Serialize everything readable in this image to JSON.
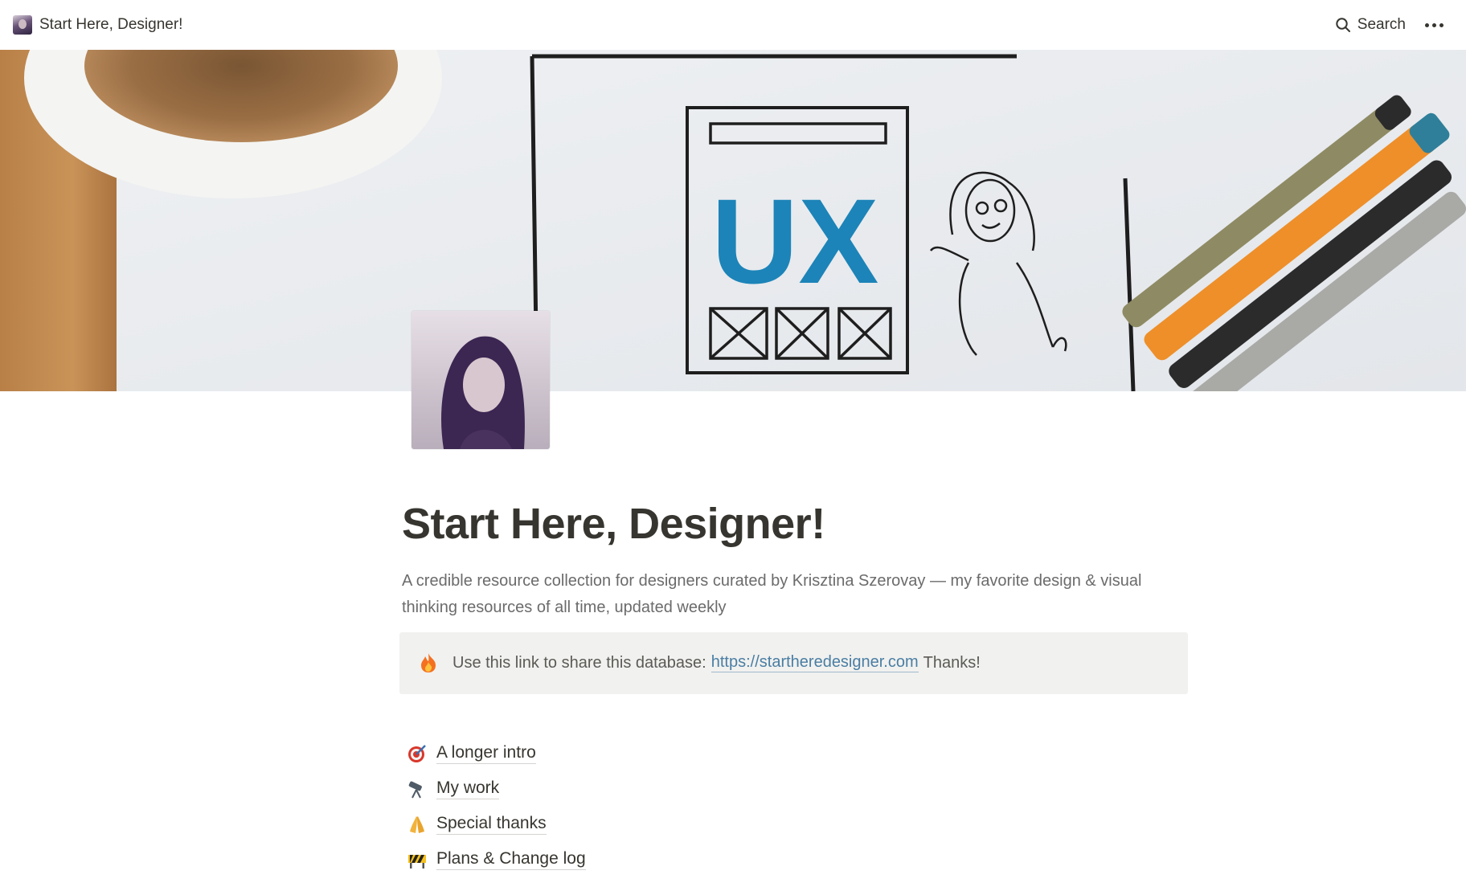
{
  "topbar": {
    "breadcrumb_title": "Start Here, Designer!",
    "search_label": "Search"
  },
  "cover": {
    "sketch_text": "UX"
  },
  "page": {
    "title": "Start Here, Designer!",
    "description": "A credible resource collection for designers curated by Krisztina Szerovay — my favorite design & visual thinking resources of all time, updated weekly"
  },
  "callout": {
    "icon": "fire-icon",
    "text_before": "Use this link to share this database:",
    "link_text": "https://startheredesigner.com",
    "text_after": "Thanks!"
  },
  "links": [
    {
      "icon": "dart-target-icon",
      "label": "A longer intro"
    },
    {
      "icon": "telescope-icon",
      "label": "My work"
    },
    {
      "icon": "folded-hands-icon",
      "label": "Special thanks"
    },
    {
      "icon": "construction-sign-icon",
      "label": "Plans & Change log"
    }
  ],
  "colors": {
    "text": "#37352f",
    "muted": "#6b6b6b",
    "link": "#4a7ea3",
    "callout_bg": "#f1f1ef",
    "ux_blue": "#1c84b8"
  }
}
